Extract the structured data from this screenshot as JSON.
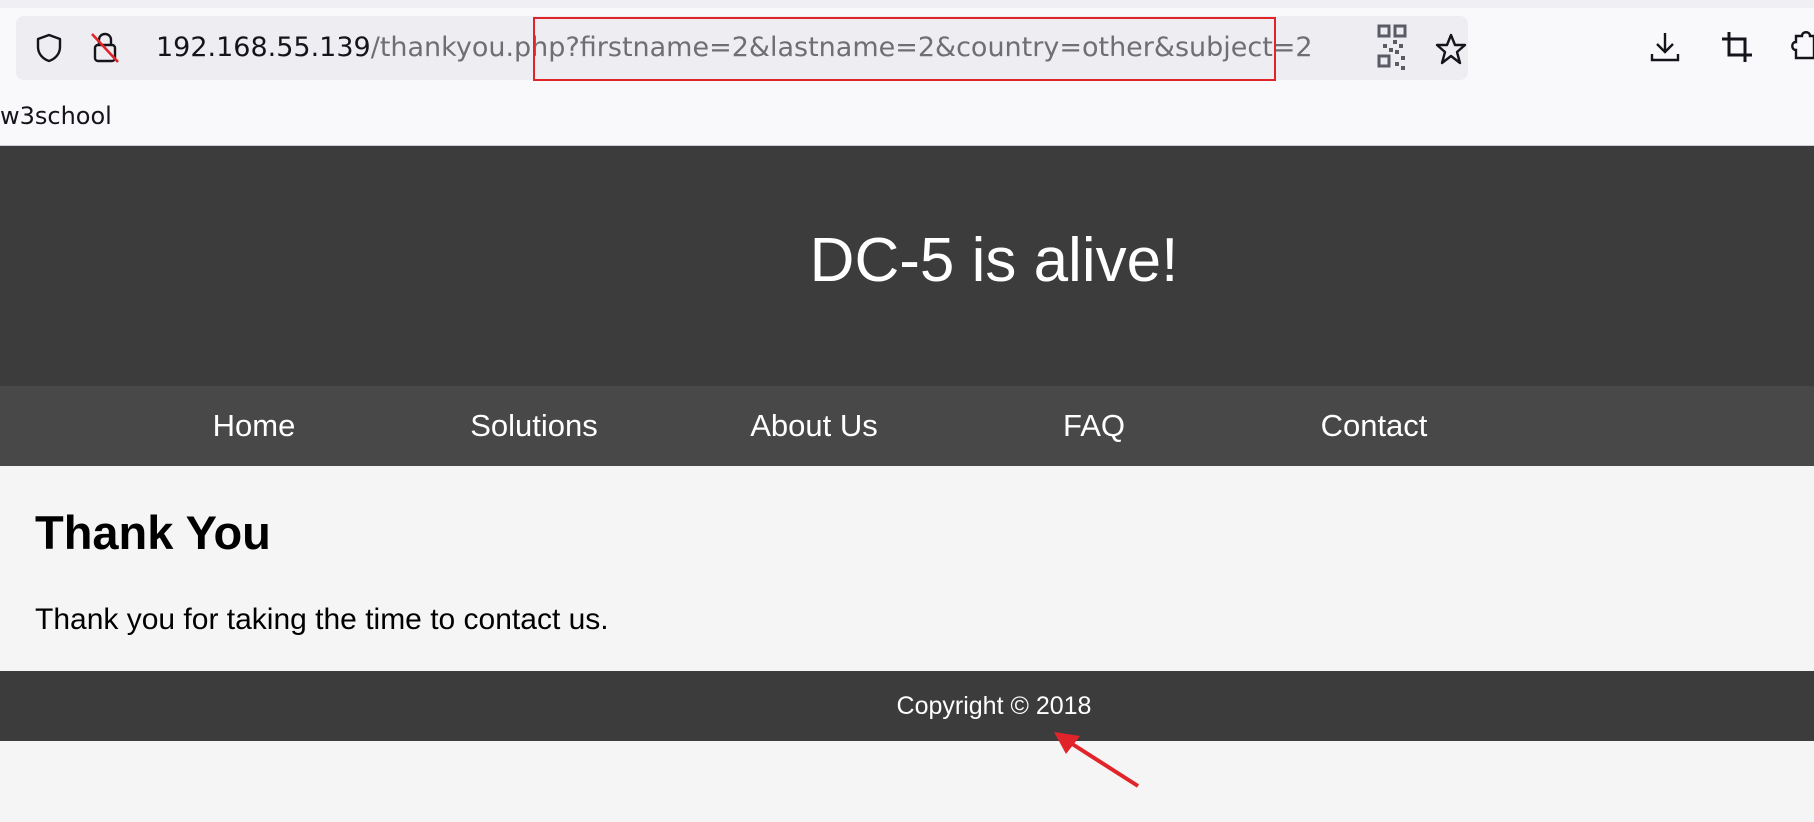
{
  "browser": {
    "url_host": "192.168.55.139",
    "url_path": "/thankyou.php",
    "url_query": "?firstname=2&lastname=2&country=other&subject=2",
    "bookmark_label": "w3school",
    "icons": [
      "shield-icon",
      "lock-warning-icon",
      "qr-code-icon",
      "star-icon",
      "download-icon",
      "crop-icon",
      "extension-icon"
    ]
  },
  "site": {
    "title": "DC-5 is alive!",
    "nav": [
      "Home",
      "Solutions",
      "About Us",
      "FAQ",
      "Contact"
    ],
    "heading": "Thank You",
    "message": "Thank you for taking the time to contact us.",
    "footer": "Copyright © 2018"
  },
  "colors": {
    "header_bg": "#3c3c3c",
    "nav_bg": "#484848",
    "page_bg": "#f5f5f5",
    "annotation": "#e0242a"
  }
}
